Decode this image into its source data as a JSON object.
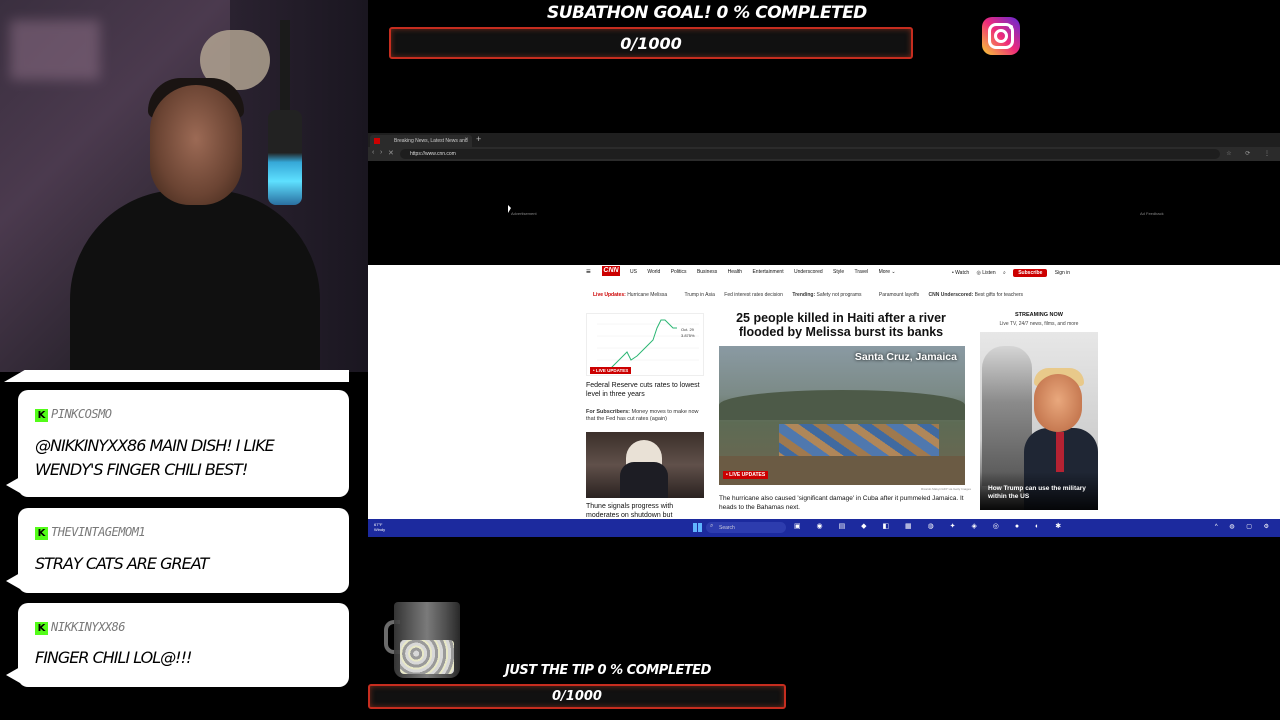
{
  "overlay": {
    "subathon_goal": {
      "title": "SUBATHON GOAL! 0 % COMPLETED",
      "value": "0/1000",
      "progress": 0
    },
    "tip_goal": {
      "title": "JUST THE TIP 0 % COMPLETED",
      "value": "0/1000",
      "progress": 0
    },
    "instagram_icon": "instagram-icon"
  },
  "browser": {
    "tab_title": "Breaking News, Latest News and",
    "tab_close": "×",
    "new_tab": "+",
    "back": "‹",
    "forward": "›",
    "reload": "✕",
    "url": "https://www.cnn.com",
    "toolbar_icons": "☆ ⟳ ⋮",
    "ad_label": "Advertisement",
    "ad_feedback": "Ad Feedback"
  },
  "cnn": {
    "menu_icon": "≡",
    "logo": "CNN",
    "nav": [
      "US",
      "World",
      "Politics",
      "Business",
      "Health",
      "Entertainment",
      "Underscored",
      "Style",
      "Travel",
      "More ⌄"
    ],
    "watch": "• Watch",
    "listen": "◎ Listen",
    "search_icon": "⌕",
    "subscribe": "Subscribe",
    "sign_in": "Sign in",
    "trending": {
      "live_label": "Live Updates:",
      "live_item": "Hurricane Melissa",
      "item2": "Trump in Asia",
      "item3": "Fed interest rates decision",
      "trending_label": "Trending:",
      "trending_item": "Safety not programs",
      "item5": "Paramount layoffs",
      "underscored_label": "CNN Underscored:",
      "underscored_item": "Best gifts for teachers"
    },
    "left": {
      "chart_tag": "Oct. 29",
      "chart_value": "3.875%",
      "live_updates": "• LIVE UPDATES",
      "story1": "Federal Reserve cuts rates to lowest level in three years",
      "subscribers_label": "For Subscribers:",
      "subscribers_text": "Money moves to make now that the Fed has cut rates (again)",
      "story2": "Thune signals progress with moderates on shutdown but"
    },
    "center": {
      "headline": "25 people killed in Haiti after a river flooded by Melissa burst its banks",
      "location": "Santa Cruz, Jamaica",
      "live_updates": "• LIVE UPDATES",
      "photo_credit": "Ricardo Makyn/AFP via Getty Images",
      "subhead": "The hurricane also caused 'significant damage' in Cuba after it pummeled Jamaica. It heads to the Bahamas next."
    },
    "right": {
      "streaming_label": "STREAMING NOW",
      "streaming_sub": "Live TV, 24/7 news, films, and more",
      "caption": "How Trump can use the military within the US"
    }
  },
  "taskbar": {
    "weather": "67°F\nWindy",
    "search": "Search",
    "app_icons": "▣ ◉ ▤ ◆ ◧ ▦ ◍ ✦ ◈ ◎ ● ◐ ✱",
    "tray": "^ ◍ ▢ ⚙"
  },
  "chat": [
    {
      "user": "PINKCOSMO",
      "text": "@NIKKINYXX86 MAIN DISH! I LIKE WENDY'S FINGER CHILI BEST!"
    },
    {
      "user": "THEVINTAGEMOM1",
      "text": "STRAY CATS ARE GREAT"
    },
    {
      "user": "NIKKINYXX86",
      "text": "FINGER CHILI LOL@!!!"
    }
  ],
  "kick_badge": "K",
  "colors": {
    "goal_border": "#c62d1f",
    "kick_green": "#53fc18",
    "cnn_red": "#cc0000",
    "taskbar_blue": "#1c2a9e"
  }
}
